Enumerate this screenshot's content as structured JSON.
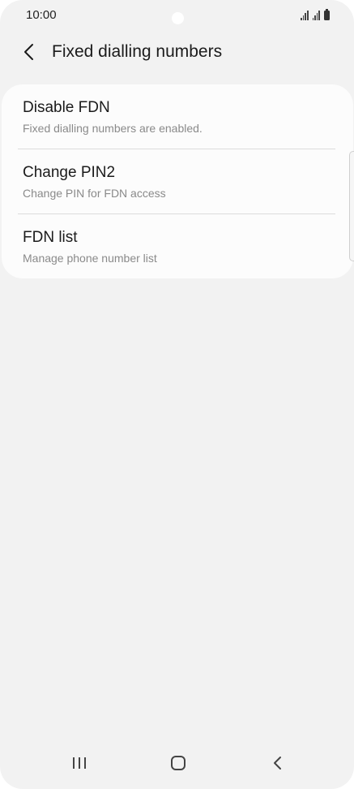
{
  "status_bar": {
    "time": "10:00"
  },
  "header": {
    "title": "Fixed dialling numbers"
  },
  "items": [
    {
      "title": "Disable FDN",
      "subtitle": "Fixed dialling numbers are enabled."
    },
    {
      "title": "Change PIN2",
      "subtitle": "Change PIN for FDN access"
    },
    {
      "title": "FDN list",
      "subtitle": "Manage phone number list"
    }
  ],
  "icons": {
    "back": "chevron-left-icon",
    "recents": "recent-apps-icon",
    "home": "home-icon",
    "nav_back": "nav-back-icon",
    "signal": "signal-icon",
    "battery": "battery-icon"
  },
  "colors": {
    "background": "#f2f2f2",
    "card": "#fcfcfc",
    "title_text": "#1b1b1b",
    "subtitle_text": "#8a8a8a"
  }
}
